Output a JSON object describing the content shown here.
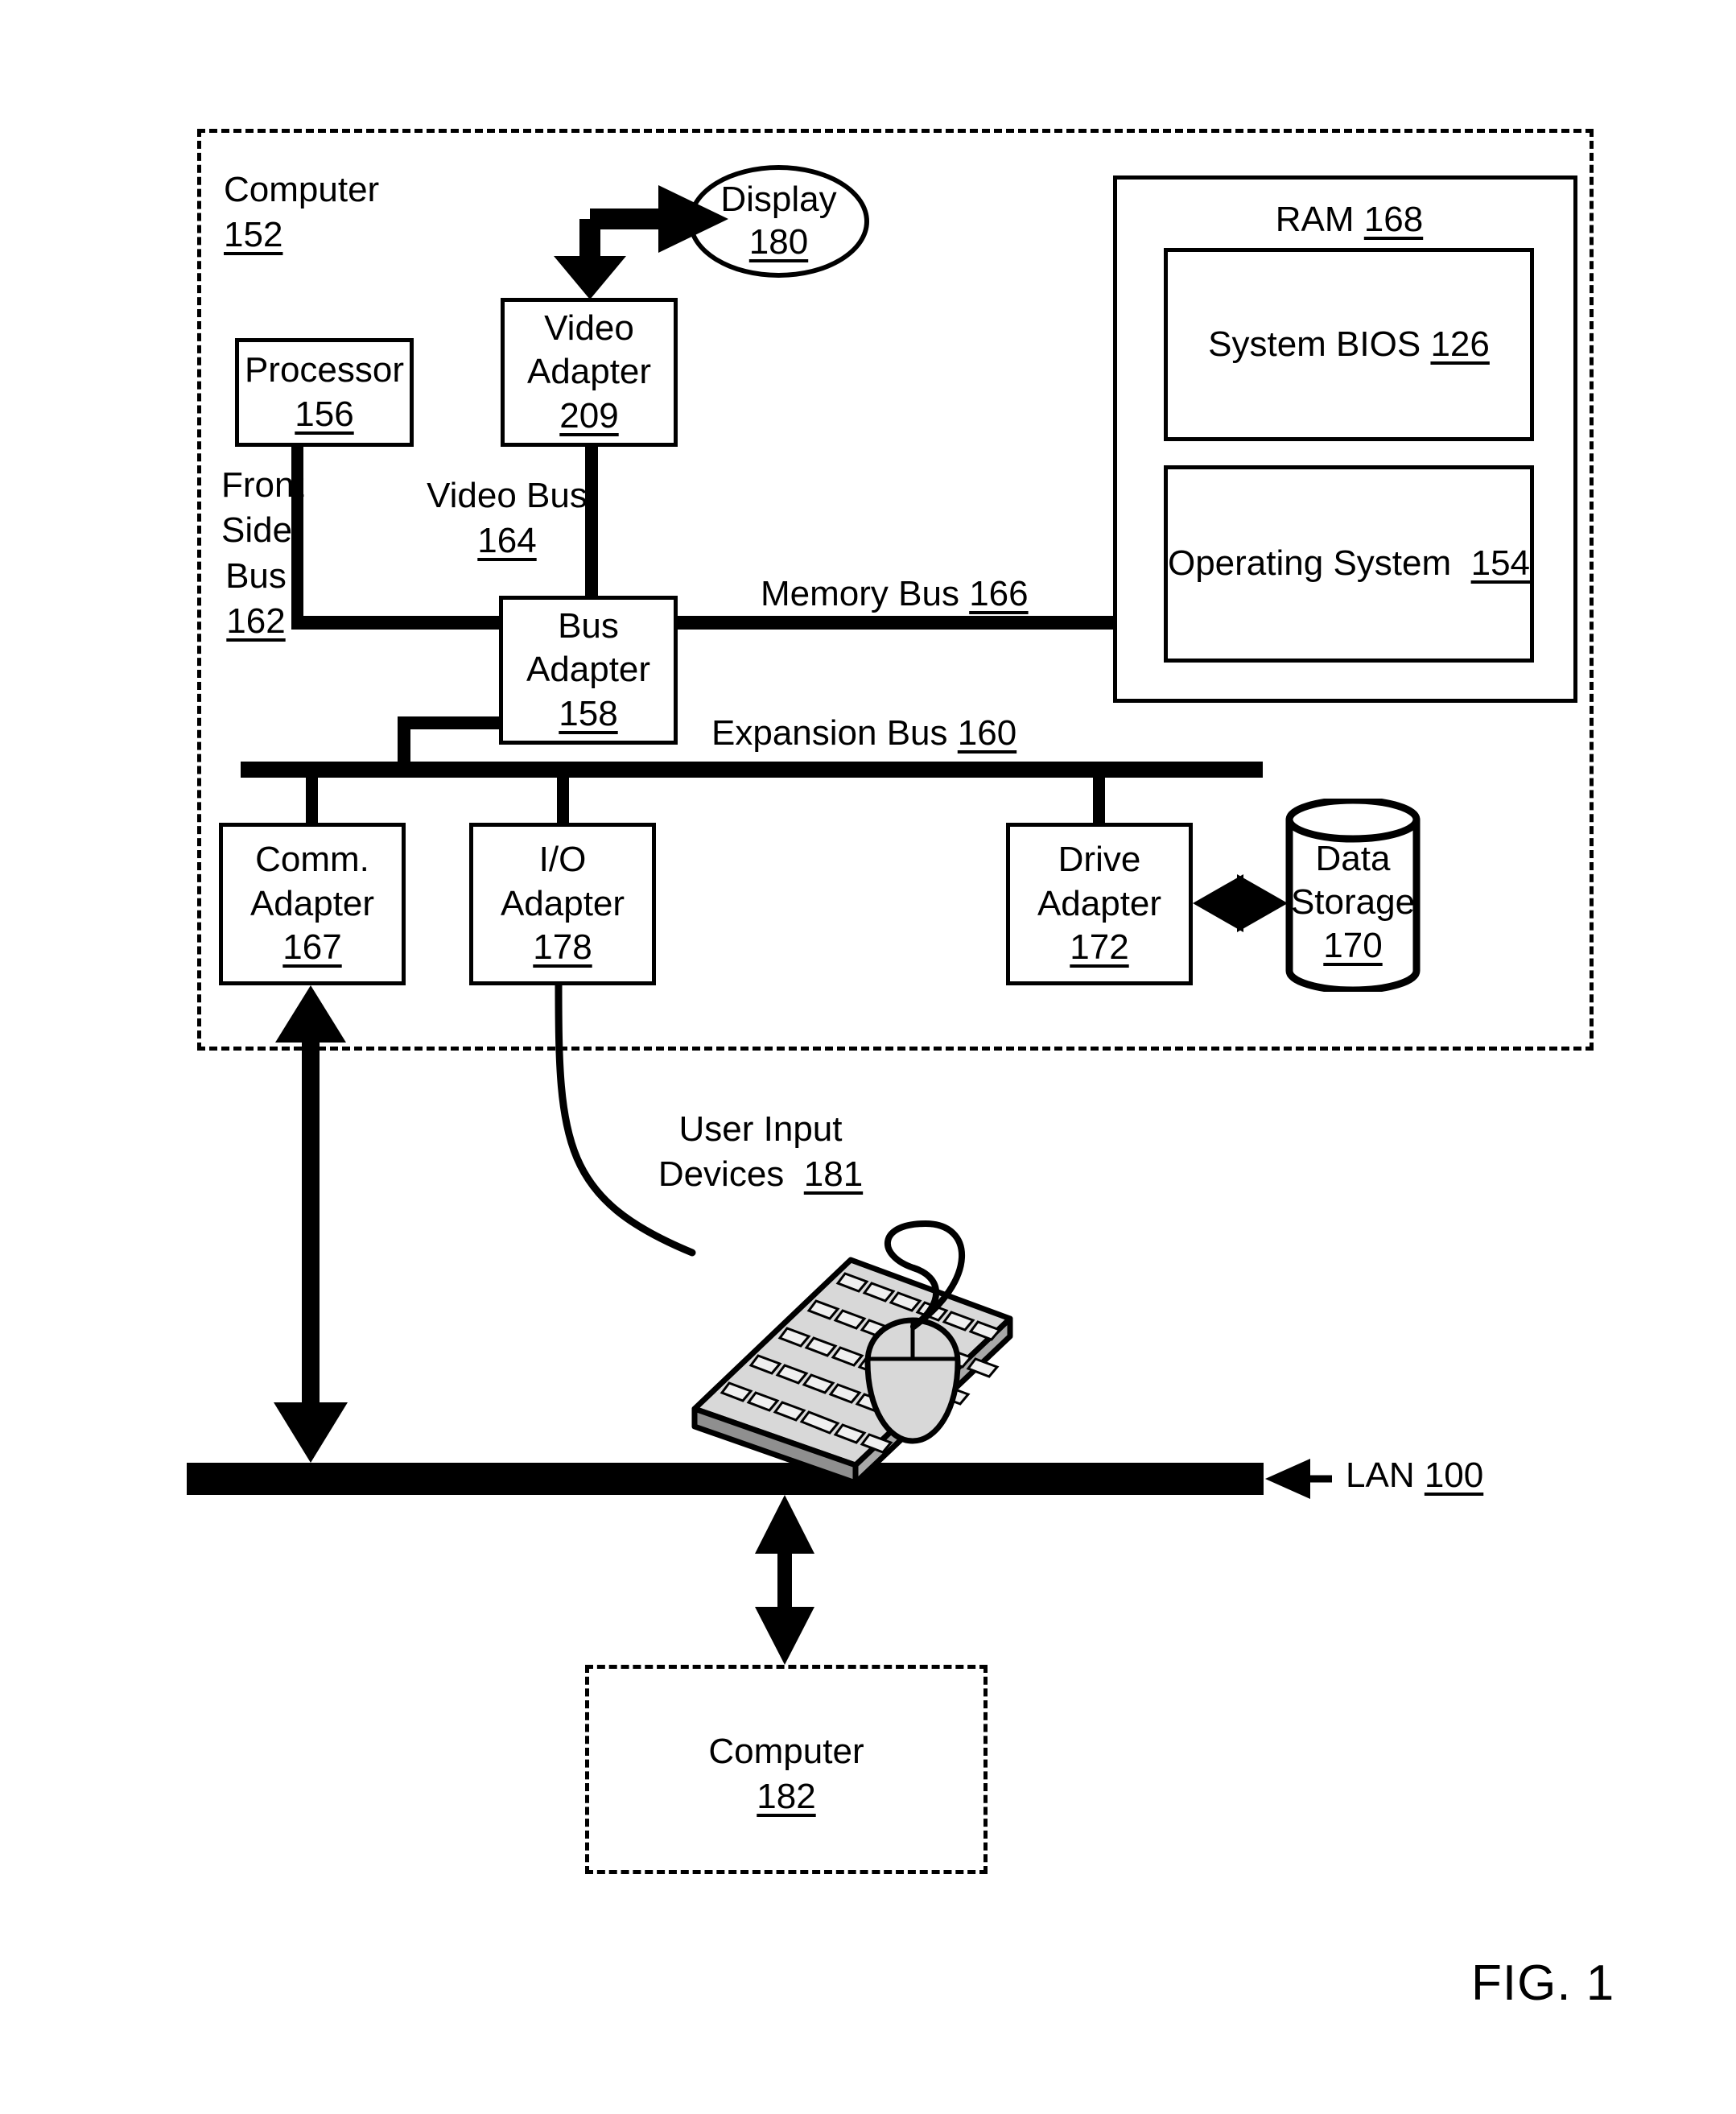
{
  "figure": {
    "label": "FIG. 1"
  },
  "outer_computer": {
    "name": "Computer",
    "ref": "152"
  },
  "display": {
    "name": "Display",
    "ref": "180"
  },
  "video_adapter": {
    "line1": "Video",
    "line2": "Adapter",
    "ref": "209"
  },
  "processor": {
    "name": "Processor",
    "ref": "156"
  },
  "ram": {
    "name": "RAM",
    "ref": "168",
    "system_bios": {
      "name": "System BIOS",
      "ref": "126"
    },
    "operating_system": {
      "name": "Operating System",
      "ref": "154"
    }
  },
  "buses": {
    "front_side_bus": {
      "line1": "Front",
      "line2": "Side",
      "line3": "Bus",
      "ref": "162"
    },
    "video_bus": {
      "name": "Video Bus",
      "ref": "164"
    },
    "memory_bus": {
      "name": "Memory Bus",
      "ref": "166"
    },
    "expansion_bus": {
      "name": "Expansion Bus",
      "ref": "160"
    }
  },
  "bus_adapter": {
    "line1": "Bus",
    "line2": "Adapter",
    "ref": "158"
  },
  "comm_adapter": {
    "line1": "Comm.",
    "line2": "Adapter",
    "ref": "167"
  },
  "io_adapter": {
    "line1": "I/O",
    "line2": "Adapter",
    "ref": "178"
  },
  "drive_adapter": {
    "line1": "Drive",
    "line2": "Adapter",
    "ref": "172"
  },
  "data_storage": {
    "line1": "Data",
    "line2": "Storage",
    "ref": "170"
  },
  "user_input_devices": {
    "line1": "User Input",
    "line2": "Devices",
    "ref": "181"
  },
  "lan": {
    "name": "LAN",
    "ref": "100"
  },
  "remote_computer": {
    "name": "Computer",
    "ref": "182"
  },
  "colors": {
    "ink": "#000000",
    "paper": "#ffffff"
  }
}
